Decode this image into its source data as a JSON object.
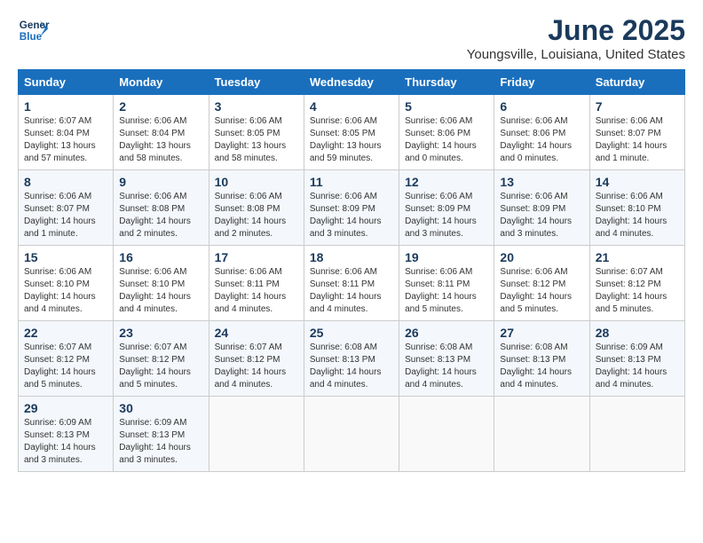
{
  "header": {
    "logo_line1": "General",
    "logo_line2": "Blue",
    "month": "June 2025",
    "location": "Youngsville, Louisiana, United States"
  },
  "weekdays": [
    "Sunday",
    "Monday",
    "Tuesday",
    "Wednesday",
    "Thursday",
    "Friday",
    "Saturday"
  ],
  "weeks": [
    [
      {
        "day": "1",
        "info": "Sunrise: 6:07 AM\nSunset: 8:04 PM\nDaylight: 13 hours\nand 57 minutes."
      },
      {
        "day": "2",
        "info": "Sunrise: 6:06 AM\nSunset: 8:04 PM\nDaylight: 13 hours\nand 58 minutes."
      },
      {
        "day": "3",
        "info": "Sunrise: 6:06 AM\nSunset: 8:05 PM\nDaylight: 13 hours\nand 58 minutes."
      },
      {
        "day": "4",
        "info": "Sunrise: 6:06 AM\nSunset: 8:05 PM\nDaylight: 13 hours\nand 59 minutes."
      },
      {
        "day": "5",
        "info": "Sunrise: 6:06 AM\nSunset: 8:06 PM\nDaylight: 14 hours\nand 0 minutes."
      },
      {
        "day": "6",
        "info": "Sunrise: 6:06 AM\nSunset: 8:06 PM\nDaylight: 14 hours\nand 0 minutes."
      },
      {
        "day": "7",
        "info": "Sunrise: 6:06 AM\nSunset: 8:07 PM\nDaylight: 14 hours\nand 1 minute."
      }
    ],
    [
      {
        "day": "8",
        "info": "Sunrise: 6:06 AM\nSunset: 8:07 PM\nDaylight: 14 hours\nand 1 minute."
      },
      {
        "day": "9",
        "info": "Sunrise: 6:06 AM\nSunset: 8:08 PM\nDaylight: 14 hours\nand 2 minutes."
      },
      {
        "day": "10",
        "info": "Sunrise: 6:06 AM\nSunset: 8:08 PM\nDaylight: 14 hours\nand 2 minutes."
      },
      {
        "day": "11",
        "info": "Sunrise: 6:06 AM\nSunset: 8:09 PM\nDaylight: 14 hours\nand 3 minutes."
      },
      {
        "day": "12",
        "info": "Sunrise: 6:06 AM\nSunset: 8:09 PM\nDaylight: 14 hours\nand 3 minutes."
      },
      {
        "day": "13",
        "info": "Sunrise: 6:06 AM\nSunset: 8:09 PM\nDaylight: 14 hours\nand 3 minutes."
      },
      {
        "day": "14",
        "info": "Sunrise: 6:06 AM\nSunset: 8:10 PM\nDaylight: 14 hours\nand 4 minutes."
      }
    ],
    [
      {
        "day": "15",
        "info": "Sunrise: 6:06 AM\nSunset: 8:10 PM\nDaylight: 14 hours\nand 4 minutes."
      },
      {
        "day": "16",
        "info": "Sunrise: 6:06 AM\nSunset: 8:10 PM\nDaylight: 14 hours\nand 4 minutes."
      },
      {
        "day": "17",
        "info": "Sunrise: 6:06 AM\nSunset: 8:11 PM\nDaylight: 14 hours\nand 4 minutes."
      },
      {
        "day": "18",
        "info": "Sunrise: 6:06 AM\nSunset: 8:11 PM\nDaylight: 14 hours\nand 4 minutes."
      },
      {
        "day": "19",
        "info": "Sunrise: 6:06 AM\nSunset: 8:11 PM\nDaylight: 14 hours\nand 5 minutes."
      },
      {
        "day": "20",
        "info": "Sunrise: 6:06 AM\nSunset: 8:12 PM\nDaylight: 14 hours\nand 5 minutes."
      },
      {
        "day": "21",
        "info": "Sunrise: 6:07 AM\nSunset: 8:12 PM\nDaylight: 14 hours\nand 5 minutes."
      }
    ],
    [
      {
        "day": "22",
        "info": "Sunrise: 6:07 AM\nSunset: 8:12 PM\nDaylight: 14 hours\nand 5 minutes."
      },
      {
        "day": "23",
        "info": "Sunrise: 6:07 AM\nSunset: 8:12 PM\nDaylight: 14 hours\nand 5 minutes."
      },
      {
        "day": "24",
        "info": "Sunrise: 6:07 AM\nSunset: 8:12 PM\nDaylight: 14 hours\nand 4 minutes."
      },
      {
        "day": "25",
        "info": "Sunrise: 6:08 AM\nSunset: 8:13 PM\nDaylight: 14 hours\nand 4 minutes."
      },
      {
        "day": "26",
        "info": "Sunrise: 6:08 AM\nSunset: 8:13 PM\nDaylight: 14 hours\nand 4 minutes."
      },
      {
        "day": "27",
        "info": "Sunrise: 6:08 AM\nSunset: 8:13 PM\nDaylight: 14 hours\nand 4 minutes."
      },
      {
        "day": "28",
        "info": "Sunrise: 6:09 AM\nSunset: 8:13 PM\nDaylight: 14 hours\nand 4 minutes."
      }
    ],
    [
      {
        "day": "29",
        "info": "Sunrise: 6:09 AM\nSunset: 8:13 PM\nDaylight: 14 hours\nand 3 minutes."
      },
      {
        "day": "30",
        "info": "Sunrise: 6:09 AM\nSunset: 8:13 PM\nDaylight: 14 hours\nand 3 minutes."
      },
      null,
      null,
      null,
      null,
      null
    ]
  ]
}
